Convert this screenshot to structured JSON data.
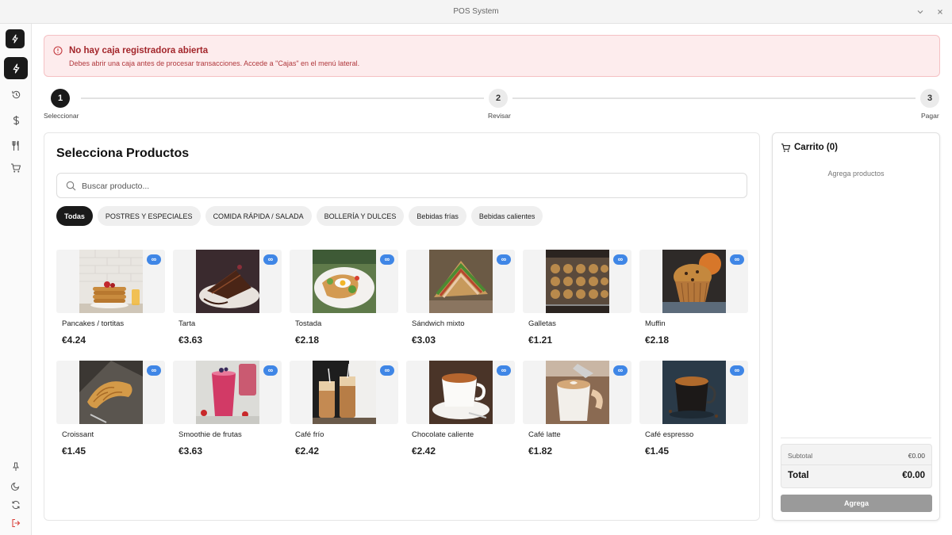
{
  "window": {
    "title": "POS System"
  },
  "alert": {
    "title": "No hay caja registradora abierta",
    "message": "Debes abrir una caja antes de procesar transacciones. Accede a \"Cajas\" en el menú lateral."
  },
  "stepper": {
    "steps": [
      {
        "number": "1",
        "label": "Seleccionar",
        "active": true
      },
      {
        "number": "2",
        "label": "Revisar",
        "active": false
      },
      {
        "number": "3",
        "label": "Pagar",
        "active": false
      }
    ]
  },
  "products": {
    "title": "Selecciona Productos",
    "search_placeholder": "Buscar producto...",
    "categories": [
      {
        "label": "Todas",
        "active": true
      },
      {
        "label": "POSTRES Y ESPECIALES",
        "active": false
      },
      {
        "label": "COMIDA RÁPIDA / SALADA",
        "active": false
      },
      {
        "label": "BOLLERÍA Y DULCES",
        "active": false
      },
      {
        "label": "Bebidas frías",
        "active": false
      },
      {
        "label": "Bebidas calientes",
        "active": false
      }
    ],
    "stock_badge": "∞",
    "items": [
      {
        "name": "Pancakes / tortitas",
        "price": "€4.24"
      },
      {
        "name": "Tarta",
        "price": "€3.63"
      },
      {
        "name": "Tostada",
        "price": "€2.18"
      },
      {
        "name": "Sándwich mixto",
        "price": "€3.03"
      },
      {
        "name": "Galletas",
        "price": "€1.21"
      },
      {
        "name": "Muffin",
        "price": "€2.18"
      },
      {
        "name": "Croissant",
        "price": "€1.45"
      },
      {
        "name": "Smoothie de frutas",
        "price": "€3.63"
      },
      {
        "name": "Café frío",
        "price": "€2.42"
      },
      {
        "name": "Chocolate caliente",
        "price": "€2.42"
      },
      {
        "name": "Café latte",
        "price": "€1.82"
      },
      {
        "name": "Café espresso",
        "price": "€1.45"
      }
    ]
  },
  "cart": {
    "title": "Carrito (0)",
    "empty_text": "Agrega productos",
    "subtotal_label": "Subtotal",
    "subtotal_value": "€0.00",
    "total_label": "Total",
    "total_value": "€0.00",
    "add_button": "Agrega"
  },
  "colors": {
    "accent": "#1a1a1a",
    "badge": "#3f86e6",
    "alert_bg": "#fdeced",
    "alert_text": "#a3262b",
    "logout": "#d9443e"
  }
}
